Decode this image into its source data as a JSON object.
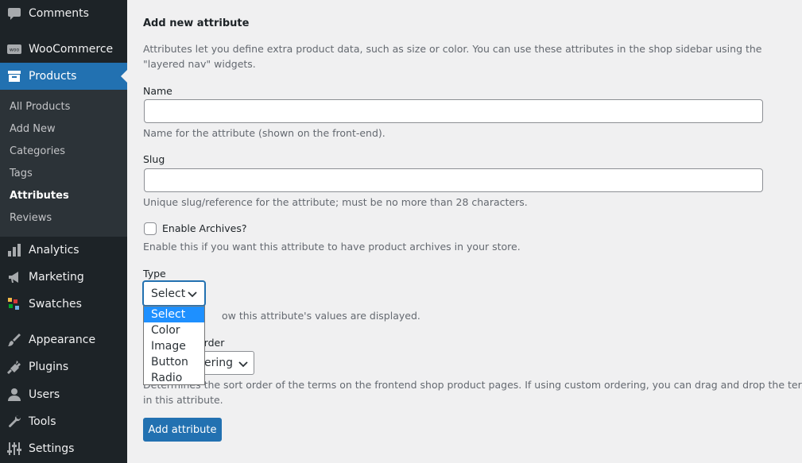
{
  "sidebar": {
    "menu": [
      {
        "label": "Comments",
        "icon": "comment-icon"
      },
      {
        "label": "WooCommerce",
        "icon": "woocommerce-icon"
      },
      {
        "label": "Products",
        "icon": "archive-icon",
        "current": true
      },
      {
        "label": "Analytics",
        "icon": "bar-chart-icon"
      },
      {
        "label": "Marketing",
        "icon": "megaphone-icon"
      },
      {
        "label": "Swatches",
        "icon": "swatches-icon"
      },
      {
        "label": "Appearance",
        "icon": "brush-icon"
      },
      {
        "label": "Plugins",
        "icon": "plug-icon"
      },
      {
        "label": "Users",
        "icon": "user-icon"
      },
      {
        "label": "Tools",
        "icon": "wrench-icon"
      },
      {
        "label": "Settings",
        "icon": "sliders-icon"
      }
    ],
    "submenu": [
      {
        "label": "All Products"
      },
      {
        "label": "Add New"
      },
      {
        "label": "Categories"
      },
      {
        "label": "Tags"
      },
      {
        "label": "Attributes",
        "active": true
      },
      {
        "label": "Reviews"
      }
    ]
  },
  "form": {
    "title": "Add new attribute",
    "intro": "Attributes let you define extra product data, such as size or color. You can use these attributes in the shop sidebar using the \"layered nav\" widgets.",
    "name_label": "Name",
    "name_value": "",
    "name_help": "Name for the attribute (shown on the front-end).",
    "slug_label": "Slug",
    "slug_value": "",
    "slug_help": "Unique slug/reference for the attribute; must be no more than 28 characters.",
    "archives_label": "Enable Archives?",
    "archives_help": "Enable this if you want this attribute to have product archives in your store.",
    "type_label": "Type",
    "type_selected": "Select",
    "type_help_visible": "ow this attribute's values are displayed.",
    "type_options": [
      "Select",
      "Color",
      "Image",
      "Button",
      "Radio"
    ],
    "order_label_visible": "order",
    "order_selected_visible": "dering",
    "order_help_line1_visible": "Determines the sort order of the terms on the frontend shop product pages. If using custom ordering, you can drag and drop the terms",
    "order_help_line2": "in this attribute.",
    "submit_label": "Add attribute"
  }
}
